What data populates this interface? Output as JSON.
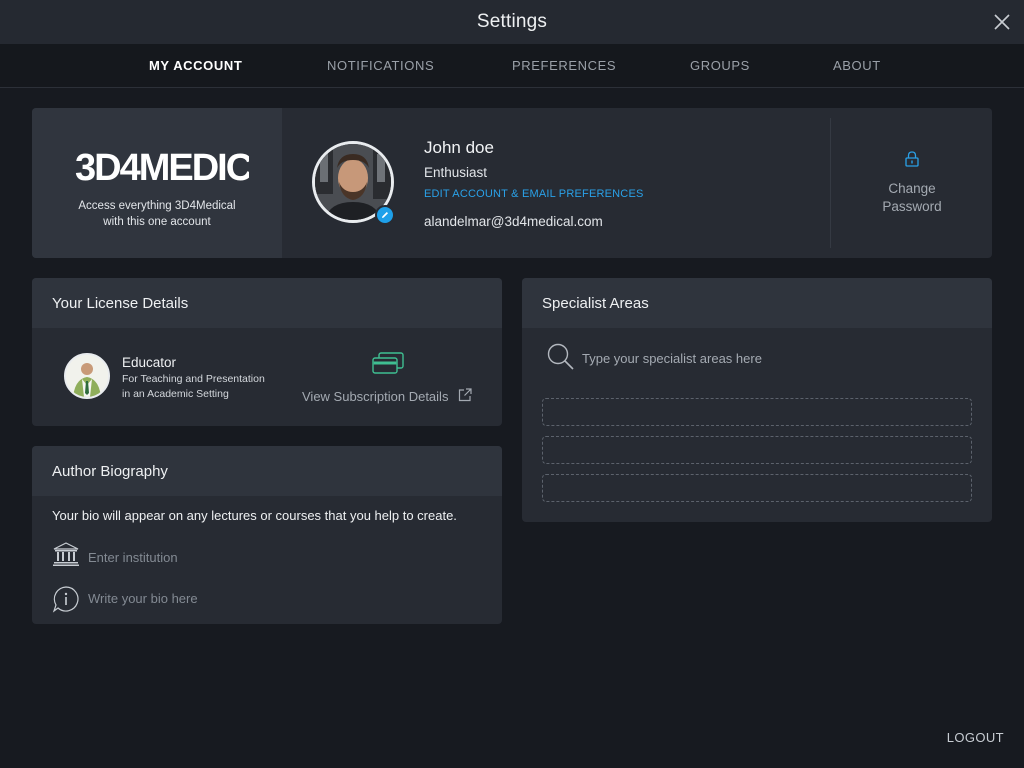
{
  "window": {
    "title": "Settings"
  },
  "tabs": [
    {
      "label": "MY ACCOUNT",
      "active": true
    },
    {
      "label": "NOTIFICATIONS",
      "active": false
    },
    {
      "label": "PREFERENCES",
      "active": false
    },
    {
      "label": "GROUPS",
      "active": false
    },
    {
      "label": "ABOUT",
      "active": false
    }
  ],
  "account": {
    "brand_logo_text": "3D4MEDICAL",
    "brand_tagline_line1": "Access everything 3D4Medical",
    "brand_tagline_line2": "with this one account",
    "user_name": "John doe",
    "user_role": "Enthusiast",
    "edit_link": "EDIT ACCOUNT & EMAIL PREFERENCES",
    "email": "alandelmar@3d4medical.com",
    "change_password_line1": "Change",
    "change_password_line2": "Password"
  },
  "license": {
    "header": "Your License Details",
    "plan_title": "Educator",
    "plan_desc_line1": "For Teaching and Presentation",
    "plan_desc_line2": "in an Academic Setting",
    "subscription_link": "View Subscription Details"
  },
  "bio": {
    "header": "Author Biography",
    "note": "Your bio will appear on any lectures or courses that you help to create.",
    "institution_placeholder": "Enter institution",
    "bio_placeholder": "Write your bio here"
  },
  "specialist": {
    "header": "Specialist Areas",
    "search_placeholder": "Type your specialist areas here",
    "slots": [
      "",
      "",
      ""
    ]
  },
  "footer": {
    "logout": "LOGOUT"
  },
  "colors": {
    "accent": "#2aa1e8",
    "background": "#171a20",
    "card": "#272b33",
    "card_header": "#2f343d",
    "subscription_icon": "#3fbf92"
  },
  "icons": {
    "close": "close-icon",
    "lock": "lock-icon",
    "edit": "pencil-icon",
    "subscription": "credit-cards-icon",
    "external": "external-link-icon",
    "institution": "institution-icon",
    "info": "info-icon",
    "search": "search-icon"
  }
}
